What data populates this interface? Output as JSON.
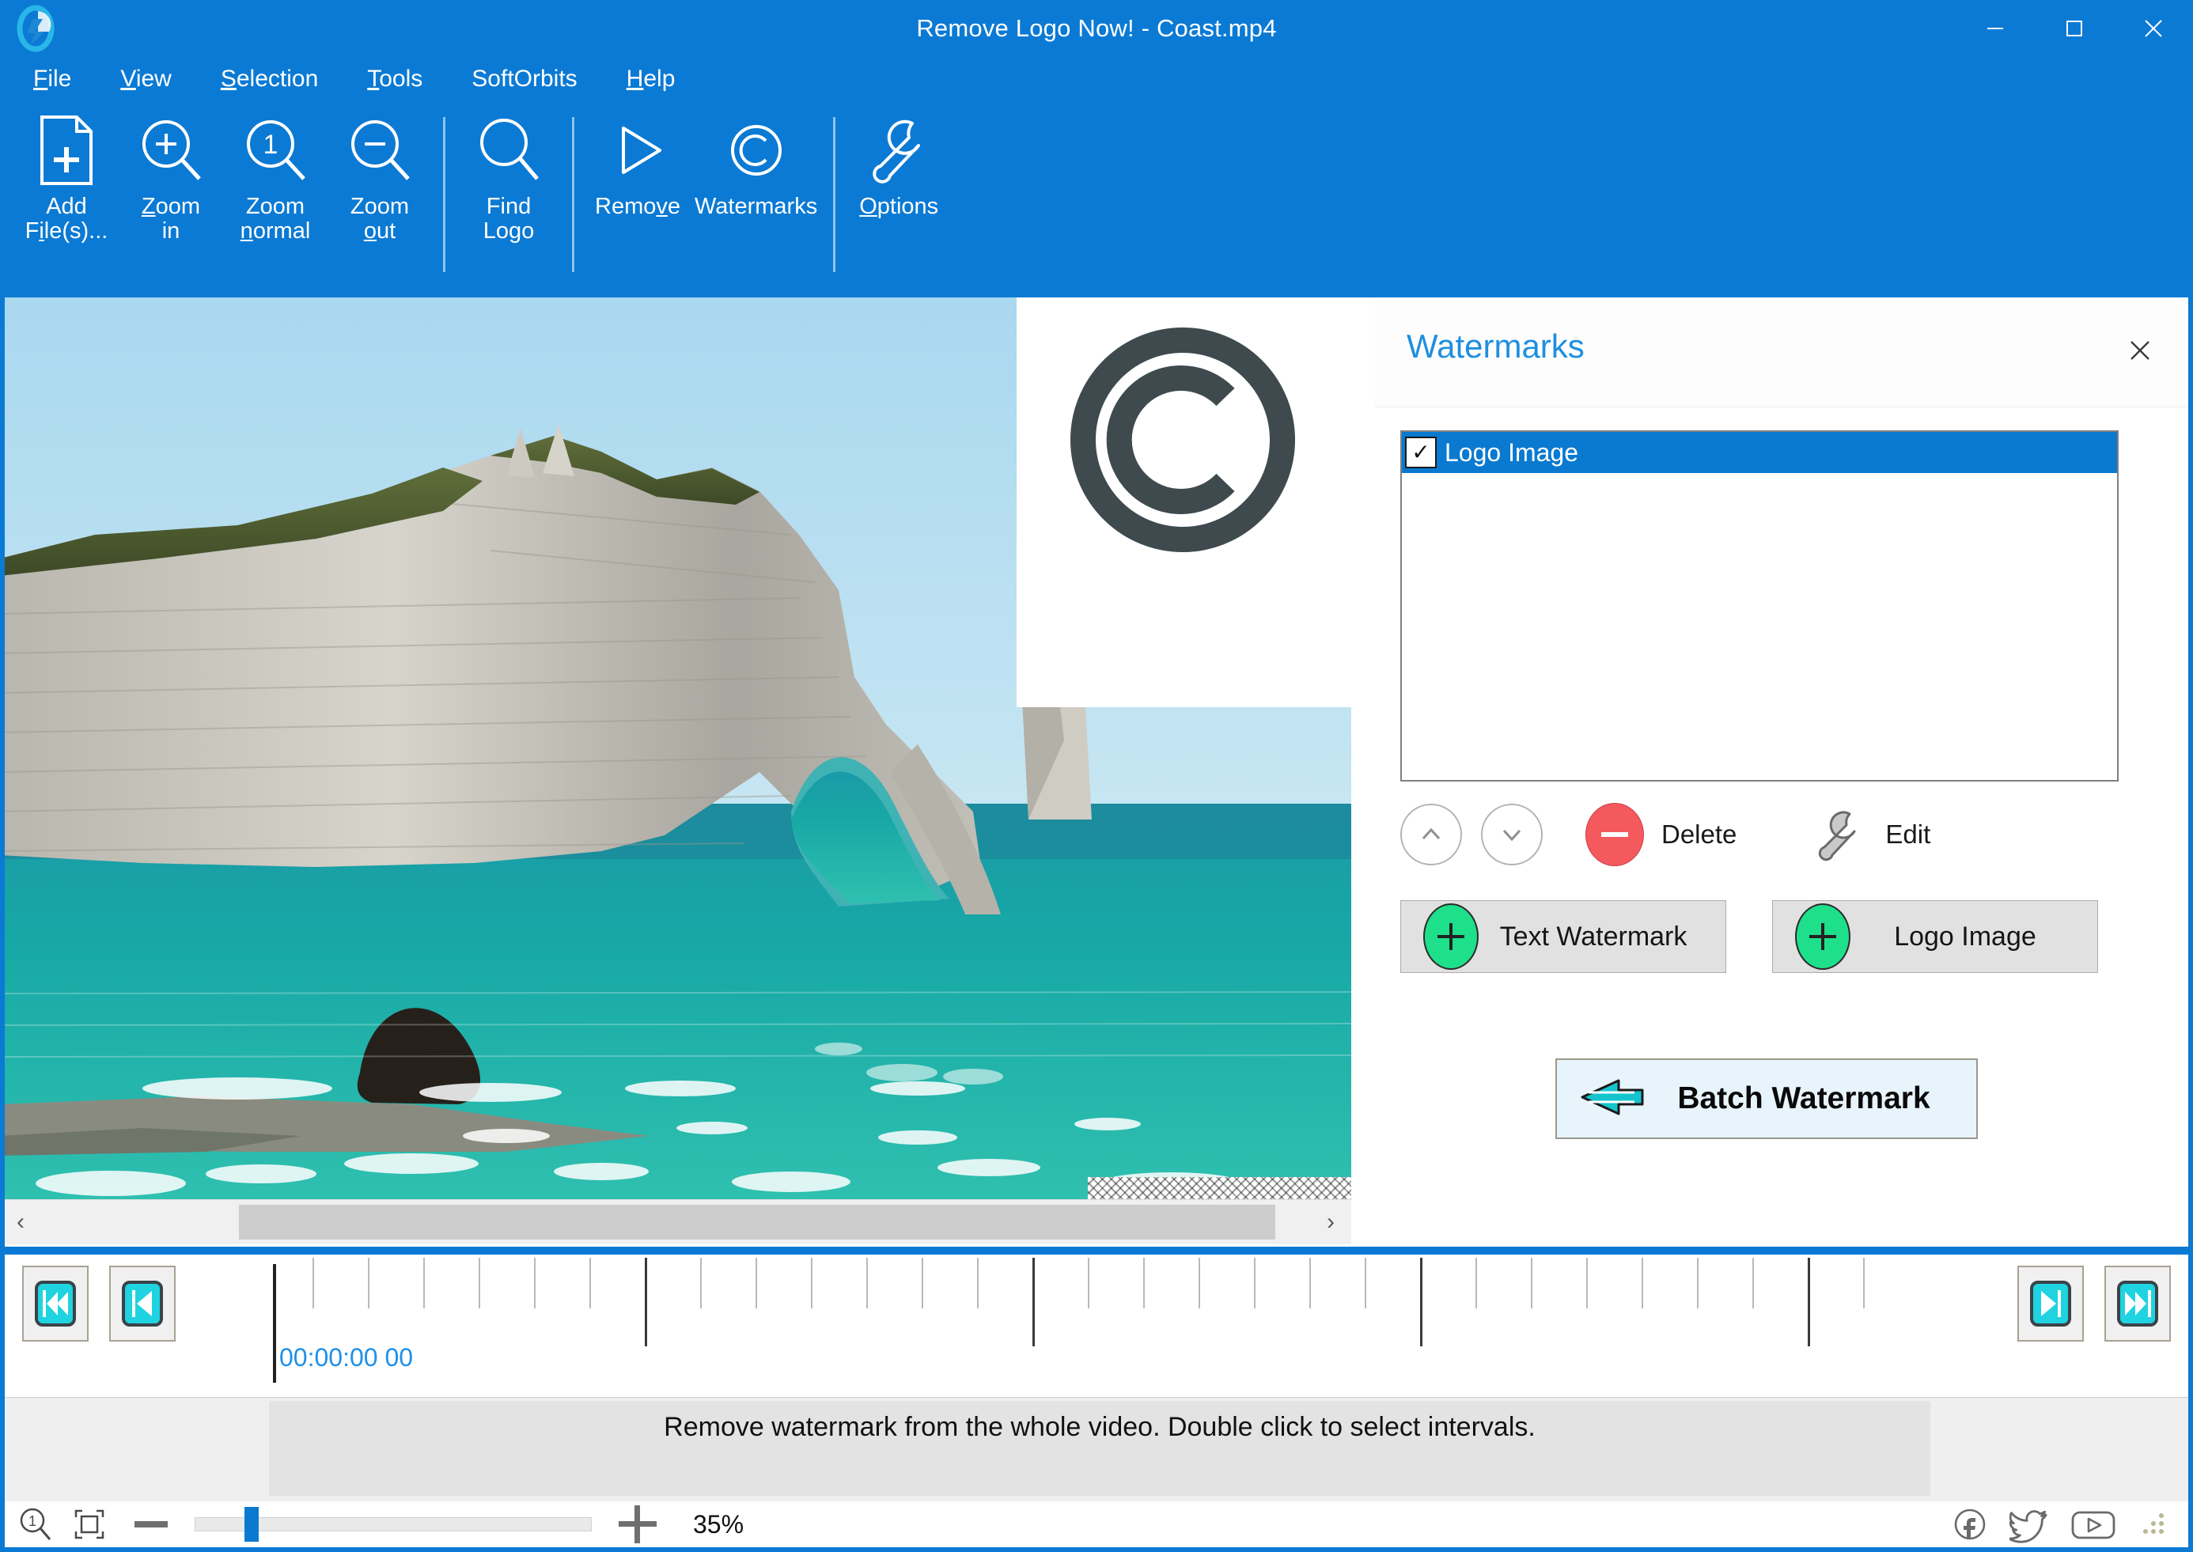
{
  "window": {
    "title": "Remove Logo Now! - Coast.mp4",
    "minimize_label": "─",
    "maximize_label": "☐",
    "close_label": "✕",
    "accent_color": "#0b7ad4"
  },
  "menu": {
    "items": [
      {
        "label": "File",
        "accel": "F"
      },
      {
        "label": "View",
        "accel": "V"
      },
      {
        "label": "Selection",
        "accel": "S"
      },
      {
        "label": "Tools",
        "accel": "T"
      },
      {
        "label": "SoftOrbits",
        "accel": ""
      },
      {
        "label": "Help",
        "accel": "H"
      }
    ]
  },
  "toolbar": {
    "items": [
      {
        "icon": "add-file-icon",
        "label": "Add\nFile(s)..."
      },
      {
        "icon": "zoom-in-icon",
        "label": "Zoom\nin"
      },
      {
        "icon": "zoom-normal-icon",
        "label": "Zoom\nnormal"
      },
      {
        "icon": "zoom-out-icon",
        "label": "Zoom\nout"
      },
      {
        "icon": "find-logo-icon",
        "label": "Find\nLogo"
      },
      {
        "icon": "remove-play-icon",
        "label": "Remove"
      },
      {
        "icon": "watermarks-copyright-icon",
        "label": "Watermarks"
      },
      {
        "icon": "options-wrench-icon",
        "label": "Options"
      }
    ]
  },
  "preview": {
    "watermark_overlay": "copyright-symbol",
    "scroll_left_label": "‹",
    "scroll_right_label": "›"
  },
  "panel": {
    "title": "Watermarks",
    "close_label": "✕",
    "list": [
      {
        "label": "Logo Image",
        "checked": true,
        "check_glyph": "✓"
      }
    ],
    "move_up_label": "⌃",
    "move_down_label": "⌄",
    "delete_label": "Delete",
    "edit_label": "Edit",
    "add_text_label": "Text Watermark",
    "add_logo_label": "Logo Image",
    "batch_label": "Batch Watermark",
    "colors": {
      "title": "#1e8fe0",
      "selection": "#0a7ad0",
      "delete_circle": "#f4595e",
      "add_circle": "#1ee08b",
      "batch_arrow": "#16b8c9"
    }
  },
  "timeline": {
    "skip_start_label": "⏮",
    "prev_frame_label": "⏴",
    "next_frame_label": "⏵",
    "skip_end_label": "⏭",
    "timecode": "00:00:00 00"
  },
  "status": {
    "message": "Remove watermark from the whole video. Double click to select intervals."
  },
  "zoombar": {
    "zoom_one_label": "zoom-actual-icon",
    "fit_label": "fit-to-window-icon",
    "minus_label": "−",
    "plus_label": "+",
    "zoom_percent": "35%",
    "slider_value": 35,
    "social": [
      {
        "name": "facebook-icon"
      },
      {
        "name": "twitter-icon"
      },
      {
        "name": "youtube-icon"
      }
    ]
  }
}
